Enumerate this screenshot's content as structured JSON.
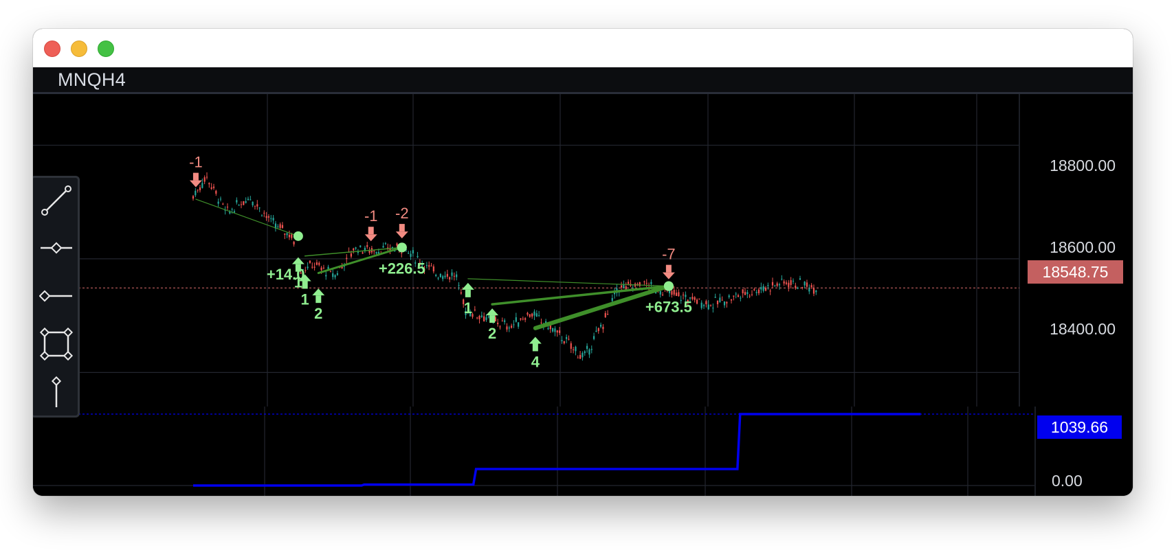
{
  "app": {
    "symbol": "MNQH4"
  },
  "colors": {
    "background": "#000000",
    "grid": "#23262f",
    "candle_up": "#26a69a",
    "candle_down": "#ef5350",
    "buy_marker": "#90ee90",
    "sell_marker": "#f28b82",
    "trade_line": "#3f8f2a",
    "equity_line": "#0000ee",
    "price_label_bg": "#c46060",
    "equity_label_bg": "#0000ee"
  },
  "price_axis": {
    "labels": [
      "18800.00",
      "18600.00",
      "18400.00"
    ],
    "current_price": "18548.75"
  },
  "equity_axis": {
    "current_value": "1039.66",
    "zero_label": "0.00"
  },
  "drawing_tools": [
    {
      "name": "trend-line-tool-icon"
    },
    {
      "name": "horizontal-line-tool-icon"
    },
    {
      "name": "horizontal-ray-tool-icon"
    },
    {
      "name": "rectangle-tool-icon"
    },
    {
      "name": "vertical-line-tool-icon"
    }
  ],
  "chart_data": [
    {
      "type": "candlestick",
      "symbol": "MNQH4",
      "ylim": [
        18340,
        18890
      ],
      "y_ticks": [
        18800,
        18600,
        18400
      ],
      "current_price": 18548.75,
      "price_path": [
        [
          0.0,
          18710
        ],
        [
          0.1,
          18745
        ],
        [
          0.25,
          18680
        ],
        [
          0.42,
          18710
        ],
        [
          0.6,
          18660
        ],
        [
          0.74,
          18640
        ],
        [
          0.77,
          18580
        ],
        [
          0.9,
          18590
        ],
        [
          1.05,
          18570
        ],
        [
          1.2,
          18620
        ],
        [
          1.35,
          18615
        ],
        [
          1.55,
          18620
        ],
        [
          1.8,
          18575
        ],
        [
          1.95,
          18570
        ],
        [
          2.02,
          18510
        ],
        [
          2.15,
          18500
        ],
        [
          2.35,
          18480
        ],
        [
          2.5,
          18505
        ],
        [
          2.7,
          18470
        ],
        [
          2.9,
          18425
        ],
        [
          3.05,
          18490
        ],
        [
          3.15,
          18548
        ],
        [
          3.35,
          18555
        ],
        [
          3.6,
          18535
        ],
        [
          3.85,
          18520
        ],
        [
          4.1,
          18540
        ],
        [
          4.4,
          18560
        ],
        [
          4.63,
          18549
        ]
      ],
      "markers": [
        {
          "side": "sell",
          "text": "-1",
          "x": 0.02,
          "price": 18720
        },
        {
          "side": "buy",
          "text": "1",
          "x": 0.78,
          "price": 18610
        },
        {
          "side": "buy",
          "text": "1",
          "x": 0.83,
          "price": 18580
        },
        {
          "side": "buy",
          "text": "2",
          "x": 0.93,
          "price": 18555
        },
        {
          "side": "sell",
          "text": "-1",
          "x": 1.32,
          "price": 18625
        },
        {
          "side": "sell",
          "text": "-2",
          "x": 1.55,
          "price": 18630
        },
        {
          "side": "buy",
          "text": "1",
          "x": 2.04,
          "price": 18565
        },
        {
          "side": "buy",
          "text": "2",
          "x": 2.22,
          "price": 18520
        },
        {
          "side": "buy",
          "text": "4",
          "x": 2.54,
          "price": 18470
        },
        {
          "side": "sell",
          "text": "-7",
          "x": 3.53,
          "price": 18558
        }
      ],
      "trades": [
        {
          "entry": [
            0.02,
            18705
          ],
          "exit": [
            0.78,
            18640
          ],
          "pnl": ""
        },
        {
          "entry": [
            0.83,
            18605
          ],
          "exit": [
            1.55,
            18620
          ],
          "pnl": "+14.0"
        },
        {
          "entry": [
            0.93,
            18575
          ],
          "exit": [
            1.55,
            18620
          ],
          "pnl": "+226.5"
        },
        {
          "entry": [
            2.04,
            18565
          ],
          "exit": [
            3.53,
            18552
          ],
          "pnl": ""
        },
        {
          "entry": [
            2.22,
            18520
          ],
          "exit": [
            3.53,
            18552
          ],
          "pnl": ""
        },
        {
          "entry": [
            2.54,
            18478
          ],
          "exit": [
            3.53,
            18552
          ],
          "pnl": "+673.5"
        }
      ]
    },
    {
      "type": "line",
      "series": [
        {
          "x": [
            0.0,
            1.25,
            1.27,
            2.08,
            2.1,
            4.04,
            4.06,
            5.4
          ],
          "values": [
            0,
            0,
            14.0,
            14.0,
            240.5,
            240.5,
            1039.66,
            1039.66
          ]
        }
      ],
      "current_value": 1039.66,
      "ylim": [
        -150,
        1150
      ]
    }
  ]
}
